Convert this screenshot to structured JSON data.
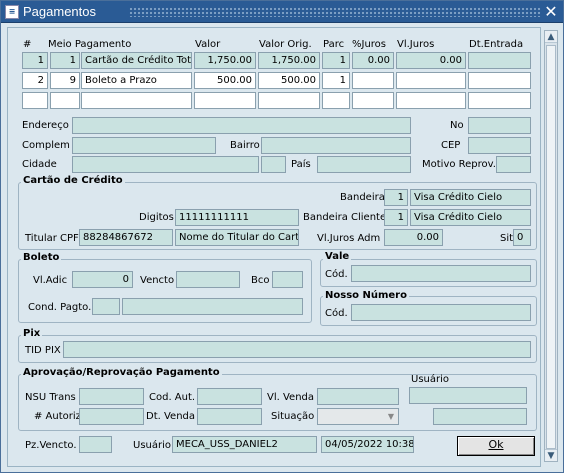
{
  "window": {
    "title": "Pagamentos",
    "icon": "app-icon"
  },
  "grid": {
    "headers": [
      "#",
      "Meio Pagamento",
      "Valor",
      "Valor Orig.",
      "Parc",
      "%Juros",
      "Vl.Juros",
      "Dt.Entrada"
    ],
    "rows": [
      {
        "num": "1",
        "meio_cod": "1",
        "meio": "Cartão de Crédito Tota",
        "valor": "1,750.00",
        "valor_orig": "1,750.00",
        "parc": "1",
        "pct_juros": "0.00",
        "vl_juros": "0.00",
        "dt_entrada": ""
      },
      {
        "num": "2",
        "meio_cod": "9",
        "meio": "Boleto a Prazo",
        "valor": "500.00",
        "valor_orig": "500.00",
        "parc": "1",
        "pct_juros": "",
        "vl_juros": "",
        "dt_entrada": ""
      },
      {
        "num": "",
        "meio_cod": "",
        "meio": "",
        "valor": "",
        "valor_orig": "",
        "parc": "",
        "pct_juros": "",
        "vl_juros": "",
        "dt_entrada": ""
      }
    ]
  },
  "address": {
    "endereco_label": "Endereço",
    "no_label": "No",
    "complem_label": "Complem",
    "bairro_label": "Bairro",
    "cep_label": "CEP",
    "cidade_label": "Cidade",
    "pais_label": "País",
    "motivo_label": "Motivo Reprov."
  },
  "cartao": {
    "title": "Cartão de Crédito",
    "bandeira_label": "Bandeira",
    "bandeira_cod": "1",
    "bandeira": "Visa Crédito Cielo",
    "digitos_label": "Digitos",
    "digitos": "11111111111",
    "bandeira_cliente_label": "Bandeira Cliente",
    "bandeira_cliente_cod": "1",
    "bandeira_cliente": "Visa Crédito Cielo",
    "titular_label": "Titular CPF",
    "titular_cpf": "88284867672",
    "titular_nome": "Nome do Titular do Cartã",
    "vljuros_label": "Vl.Juros Adm",
    "vljuros": "0.00",
    "sit_label": "Sit",
    "sit": "0"
  },
  "boleto": {
    "title": "Boleto",
    "vladic_label": "Vl.Adic",
    "vladic": "0",
    "vencto_label": "Vencto",
    "bco_label": "Bco",
    "cond_label": "Cond. Pagto."
  },
  "vale": {
    "title": "Vale",
    "cod_label": "Cód."
  },
  "nosso": {
    "title": "Nosso Número",
    "cod_label": "Cód."
  },
  "pix": {
    "title": "Pix",
    "tid_label": "TID PIX"
  },
  "aprov": {
    "title": "Aprovação/Reprovação Pagamento",
    "nsu_label": "NSU Trans",
    "codaut_label": "Cod. Aut.",
    "vlvenda_label": "Vl. Venda",
    "usuario_label": "Usuário",
    "autoriz_label": "# Autoriz",
    "dtvenda_label": "Dt. Venda",
    "situacao_label": "Situação"
  },
  "footer": {
    "pzvencto_label": "Pz.Vencto.",
    "usuario_label": "Usuário",
    "usuario": "MECA_USS_DANIEL2",
    "datetime": "04/05/2022 10:38",
    "ok_label": "Ok"
  }
}
